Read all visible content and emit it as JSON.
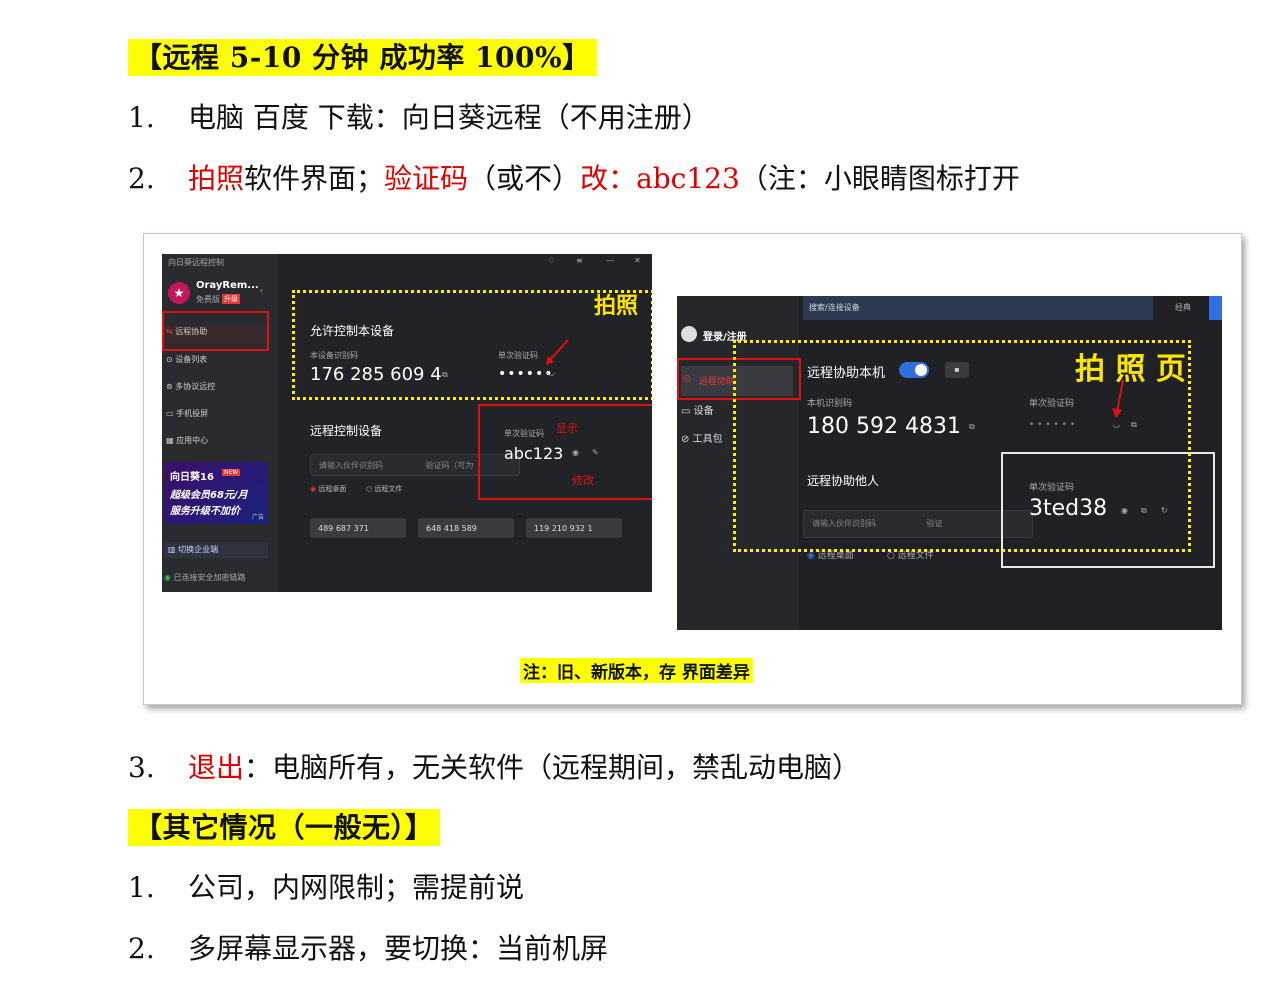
{
  "header1": "【远程 5-10 分钟  成功率 100%】",
  "step1": {
    "num": "1.",
    "text": "电脑 百度 下载：向日葵远程（不用注册）"
  },
  "step2": {
    "num": "2.",
    "a": "拍照",
    "b": "软件界面；",
    "c": "验证码",
    "d": "（或不）",
    "e": "改：abc123",
    "f": "（注：",
    "g": "小眼睛图标打开"
  },
  "step3": {
    "num": "3.",
    "a": "退出",
    "b": "：电脑所有，无关软件（远程期间，禁乱动电脑）"
  },
  "header2": "【其它情况（一般无）】",
  "other1": {
    "num": "1.",
    "text": "公司，内网限制；需提前说"
  },
  "other2": {
    "num": "2.",
    "text": "多屏幕显示器，要切换：当前机屏"
  },
  "figure": {
    "caption": "注：旧、新版本，存 界面差异",
    "old": {
      "app_title": "向日葵远程控制",
      "user": "OrayRem...",
      "user_tier": "免费版",
      "user_badge": "升级",
      "menu": [
        "远程协助",
        "设备列表",
        "多协议远控",
        "手机投屏",
        "应用中心"
      ],
      "promo_title": "向日葵16",
      "promo_badge": "NEW",
      "promo_line1": "超级会员68元/月",
      "promo_line2": "服务升级不加价",
      "promo_tag": "广告",
      "switch_enterprise": "切换企业端",
      "secure": "已连接安全加密链路",
      "allow_title": "允许控制本设备",
      "device_id_label": "本设备识别码",
      "device_id": "176 285 609 4",
      "code_label": "单次验证码",
      "code_hidden": "••••••",
      "photo_label": "拍照",
      "remote_title": "远程控制设备",
      "partner_placeholder": "请输入伙伴识别码",
      "code_input_placeholder": "验证码（可为",
      "radio_desktop": "远程桌面",
      "radio_file": "远程文件",
      "new_code_label": "单次验证码",
      "new_code": "abc123",
      "show_label": "显示",
      "modify_label": "修改",
      "recent": [
        "489 687 371",
        "648 418 589",
        "119 210 932 1"
      ]
    },
    "new": {
      "search": "搜索/连接设备",
      "tab": "经典",
      "login": "登录/注册",
      "menu": [
        "远程协助",
        "设备",
        "工具包"
      ],
      "assist_title": "远程协助本机",
      "device_id_label": "本机识别码",
      "device_id": "180 592 4831",
      "code_label": "单次验证码",
      "code_hidden": "• • • • • •",
      "photo_label": "拍 照 页",
      "assist_other": "远程协助他人",
      "partner_placeholder": "请输入伙伴识别码",
      "code_input_placeholder": "验证",
      "code_label2": "单次验证码",
      "code_value": "3ted38",
      "radio_desktop": "远程桌面",
      "radio_file": "远程文件"
    }
  }
}
